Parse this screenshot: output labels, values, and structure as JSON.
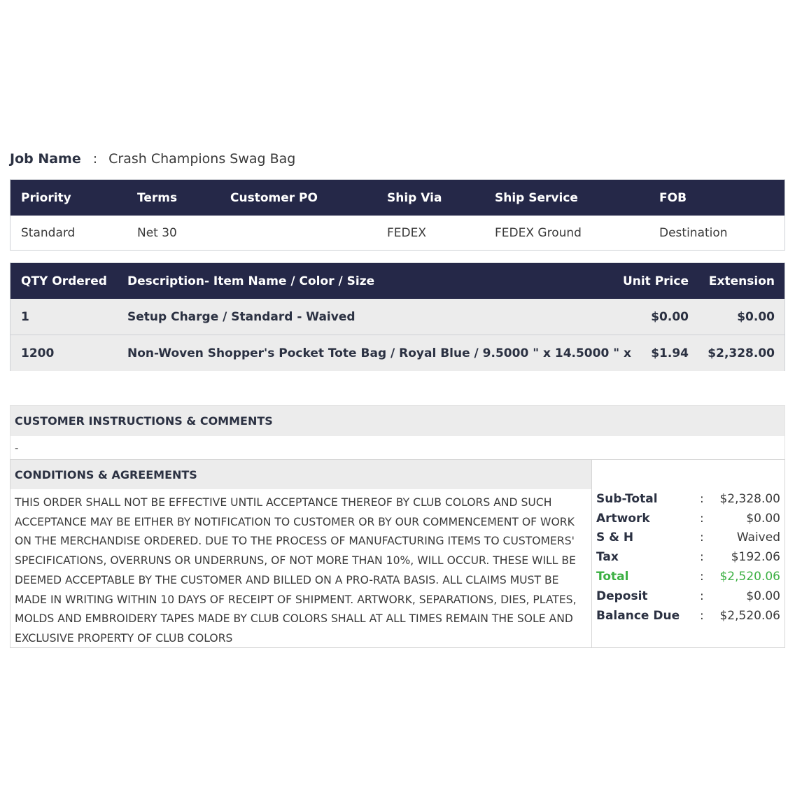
{
  "job": {
    "label": "Job Name",
    "separator": ":",
    "value": "Crash Champions Swag Bag"
  },
  "info_table": {
    "headers": [
      "Priority",
      "Terms",
      "Customer PO",
      "Ship Via",
      "Ship Service",
      "FOB"
    ],
    "row": [
      "Standard",
      "Net 30",
      "",
      "FEDEX",
      "FEDEX Ground",
      "Destination"
    ]
  },
  "items_table": {
    "headers": {
      "qty": "QTY Ordered",
      "description": "Description- Item Name / Color / Size",
      "unit_price": "Unit Price",
      "extension": "Extension"
    },
    "rows": [
      {
        "qty": "1",
        "description": "Setup Charge / Standard - Waived",
        "unit_price": "$0.00",
        "extension": "$0.00"
      },
      {
        "qty": "1200",
        "description": "Non-Woven Shopper's Pocket Tote Bag / Royal Blue / 9.5000 \" x 14.5000 \" x",
        "unit_price": "$1.94",
        "extension": "$2,328.00"
      }
    ]
  },
  "comments": {
    "title": "CUSTOMER INSTRUCTIONS & COMMENTS",
    "body": "-"
  },
  "conditions": {
    "title": "CONDITIONS & AGREEMENTS",
    "text": "THIS ORDER SHALL NOT BE EFFECTIVE UNTIL ACCEPTANCE THEREOF BY CLUB COLORS AND SUCH ACCEPTANCE MAY BE EITHER BY NOTIFICATION TO CUSTOMER OR BY OUR COMMENCEMENT OF WORK ON THE MERCHANDISE ORDERED. DUE TO THE PROCESS OF MANUFACTURING ITEMS TO CUSTOMERS' SPECIFICATIONS, OVERRUNS OR UNDERRUNS, OF NOT MORE THAN 10%, WILL OCCUR. THESE WILL BE DEEMED ACCEPTABLE BY THE CUSTOMER AND BILLED ON A PRO-RATA BASIS. ALL CLAIMS MUST BE MADE IN WRITING WITHIN 10 DAYS OF RECEIPT OF SHIPMENT. ARTWORK, SEPARATIONS, DIES, PLATES, MOLDS AND EMBROIDERY TAPES MADE BY CLUB COLORS SHALL AT ALL TIMES REMAIN THE SOLE AND EXCLUSIVE PROPERTY OF CLUB COLORS"
  },
  "totals": {
    "separator": ":",
    "rows": [
      {
        "label": "Sub-Total",
        "value": "$2,328.00"
      },
      {
        "label": "Artwork",
        "value": "$0.00"
      },
      {
        "label": "S & H",
        "value": "Waived"
      },
      {
        "label": "Tax",
        "value": "$192.06"
      },
      {
        "label": "Total",
        "value": "$2,520.06"
      },
      {
        "label": "Deposit",
        "value": "$0.00"
      },
      {
        "label": "Balance Due",
        "value": "$2,520.06"
      }
    ]
  },
  "colors": {
    "header_bg": "#252848",
    "row_bg": "#ececec",
    "total_green": "#3cb043"
  }
}
